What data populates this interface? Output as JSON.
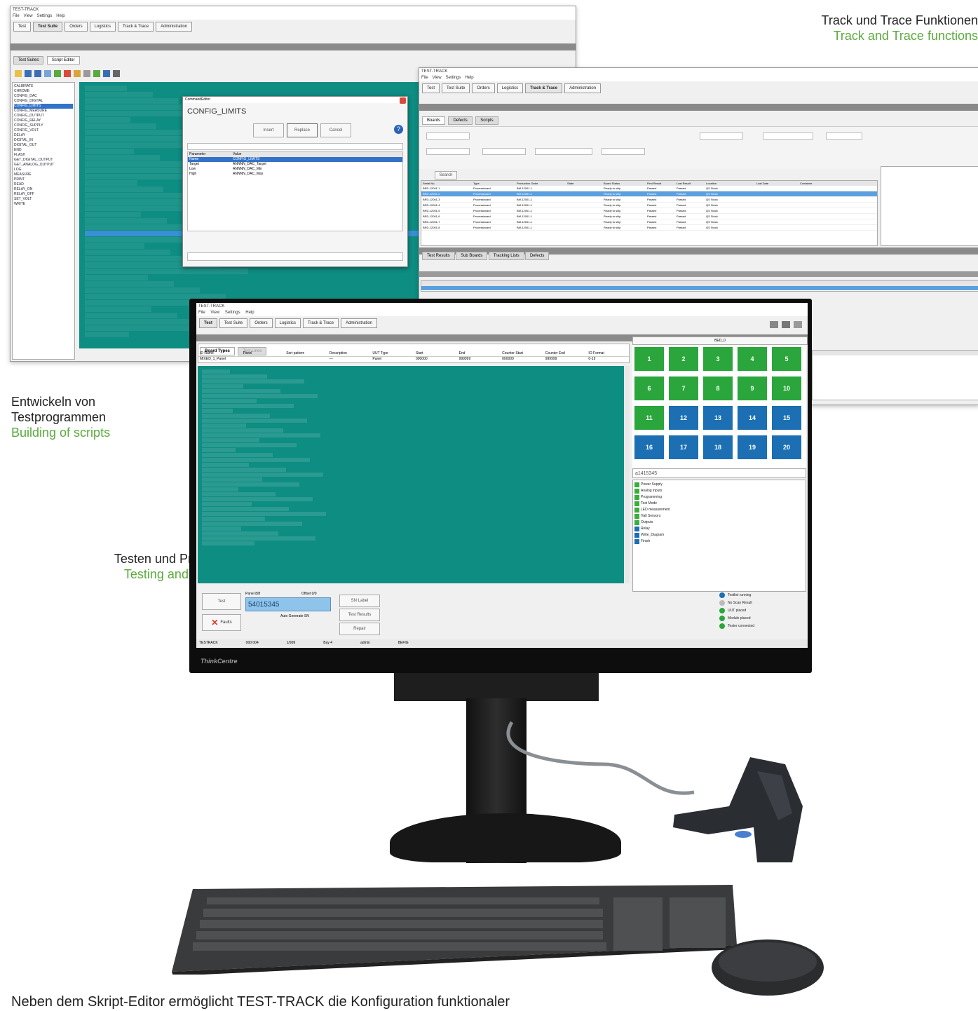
{
  "captions": {
    "track_de": "Track und Trace Funktionen",
    "track_en": "Track and Trace functions",
    "build_de_1": "Entwickeln von",
    "build_de_2": "Testprogrammen",
    "build_en": "Building of scripts",
    "test_de": "Testen und Programmieren",
    "test_en": "Testing and programming",
    "bottom": "Neben dem Skript-Editor ermöglicht TEST-TRACK die Konfiguration funktionaler"
  },
  "main_tabs": [
    "Test",
    "Test Suite",
    "Orders",
    "Logistics",
    "Track & Trace",
    "Administration"
  ],
  "editor_window": {
    "subtabs": [
      "Test Suites",
      "Script Editor"
    ],
    "dialog_title": "CONFIG_LIMITS",
    "dialog_buttons": [
      "Insert",
      "Replace",
      "Cancel"
    ],
    "dialog_columns": [
      "Parameter",
      "Value"
    ],
    "dialog_rows": [
      [
        "Name",
        "CONFIG_LIMITS"
      ],
      [
        "Target",
        "ANNNN_DAC_Target"
      ],
      [
        "Low",
        "ANNNN_DAC_Min"
      ],
      [
        "High",
        "ANNNN_DAC_Max"
      ]
    ],
    "side_list": [
      "CALIBRATE",
      "CHROME",
      "CONFIG_DAC",
      "CONFIG_DIGITAL",
      "CONFIG_LIMITS",
      "CONFIG_MEASURE",
      "CONFIG_OUTPUT",
      "CONFIG_RELAY",
      "CONFIG_SUPPLY",
      "CONFIG_VOLT",
      "DELAY",
      "DIGITAL_IN",
      "DIGITAL_OUT",
      "END",
      "FLASH",
      "GET_DIGITAL_OUTPUT",
      "GET_ANALOG_OUTPUT",
      "LOG",
      "MEASURE",
      "PRINT",
      "READ",
      "RELAY_ON",
      "RELAY_OFF",
      "SET_VOLT",
      "WRITE"
    ]
  },
  "track_window": {
    "subtabs": [
      "Boards",
      "Defects",
      "Scripts"
    ],
    "search_label": "Search",
    "columns": [
      "Serial No.",
      "Type",
      "Production Order",
      "State",
      "Board Status",
      "First Result",
      "Last Result",
      "Location",
      "Last Date",
      "Container"
    ],
    "rows": [
      [
        "BRD-12001-1",
        "Processboard",
        "BM-12001-1",
        "Ready to ship",
        "Passed",
        "Passed",
        "QS Stock"
      ],
      [
        "BRD-12001-2",
        "Processboard",
        "BM-12001-1",
        "Ready to ship",
        "Passed",
        "Passed",
        "QS Stock"
      ],
      [
        "BRD-12001-3",
        "Processboard",
        "BM-12001-1",
        "Ready to ship",
        "Passed",
        "Passed",
        "QS Stock"
      ],
      [
        "BRD-12001-4",
        "Processboard",
        "BM-12001-1",
        "Ready to ship",
        "Passed",
        "Passed",
        "QS Stock"
      ],
      [
        "BRD-12001-5",
        "Processboard",
        "BM-12001-1",
        "Ready to ship",
        "Passed",
        "Passed",
        "QS Stock"
      ],
      [
        "BRD-12001-6",
        "Processboard",
        "BM-12001-1",
        "Ready to ship",
        "Passed",
        "Passed",
        "QS Stock"
      ],
      [
        "BRD-12001-7",
        "Processboard",
        "BM-12001-1",
        "Ready to ship",
        "Passed",
        "Passed",
        "QS Stock"
      ],
      [
        "BRD-12001-8",
        "Processboard",
        "BM-12001-1",
        "Ready to ship",
        "Passed",
        "Passed",
        "QS Stock"
      ]
    ],
    "lower_tabs": [
      "Test Results",
      "Sub Boards",
      "Tracking Lists",
      "Defects"
    ]
  },
  "test_window": {
    "title": "TEST-TRACK",
    "menu": [
      "File",
      "View",
      "Settings",
      "Help"
    ],
    "subtabs": [
      "Board Types",
      "Test Lines"
    ],
    "board_columns": [
      "ID Name",
      "Panel",
      "Sort pattern",
      "Description",
      "UUT Type",
      "Start",
      "End",
      "Counter Start",
      "Counter End",
      "IO Format"
    ],
    "board_row": [
      "MIXED_1_Panel",
      "",
      "",
      "—",
      "Panel",
      "000000",
      "999999",
      "000000",
      "999999",
      "0-19"
    ],
    "panel_header": "BED_0",
    "panel_cells": [
      {
        "n": "1",
        "c": "g"
      },
      {
        "n": "2",
        "c": "g"
      },
      {
        "n": "3",
        "c": "g"
      },
      {
        "n": "4",
        "c": "g"
      },
      {
        "n": "5",
        "c": "g"
      },
      {
        "n": "6",
        "c": "g"
      },
      {
        "n": "7",
        "c": "g"
      },
      {
        "n": "8",
        "c": "g"
      },
      {
        "n": "9",
        "c": "g"
      },
      {
        "n": "10",
        "c": "g"
      },
      {
        "n": "11",
        "c": "g"
      },
      {
        "n": "12",
        "c": "b"
      },
      {
        "n": "13",
        "c": "b"
      },
      {
        "n": "14",
        "c": "b"
      },
      {
        "n": "15",
        "c": "b"
      },
      {
        "n": "16",
        "c": "b"
      },
      {
        "n": "17",
        "c": "b"
      },
      {
        "n": "18",
        "c": "b"
      },
      {
        "n": "19",
        "c": "b"
      },
      {
        "n": "20",
        "c": "b"
      }
    ],
    "serial_display": "a1415345",
    "checklist": [
      {
        "label": "Power Supply",
        "state": "g"
      },
      {
        "label": "Analog inputs",
        "state": "g"
      },
      {
        "label": "Programming",
        "state": "g"
      },
      {
        "label": "Test Mode",
        "state": "g"
      },
      {
        "label": "LED measurement",
        "state": "g"
      },
      {
        "label": "Hall Sensors",
        "state": "g"
      },
      {
        "label": "Outputs",
        "state": "g"
      },
      {
        "label": "Relay",
        "state": "b"
      },
      {
        "label": "Write_Diagram",
        "state": "b"
      },
      {
        "label": "Finish",
        "state": "b"
      }
    ],
    "panel_label": "Panel",
    "panel_count": "8/8",
    "offset_label": "Offset 0/0",
    "serial_input": "54015345",
    "auto_generate": "Auto Generate SN",
    "buttons": [
      "Test",
      "Faults",
      "SN Label",
      "Test Results",
      "Repair"
    ],
    "status": [
      {
        "label": "Testlist running",
        "color": "#1b6fb2"
      },
      {
        "label": "No Scan Result",
        "color": "#bbbbbb"
      },
      {
        "label": "UUT placed",
        "color": "#2aa63c"
      },
      {
        "label": "Module placed",
        "color": "#2aa63c"
      },
      {
        "label": "Tester connected",
        "color": "#2aa63c"
      }
    ],
    "statusbar": [
      "TESTRACK",
      "000 004",
      "1/999",
      "Bay 4",
      "admin",
      "BEFIG"
    ]
  },
  "monitor_brand": "ThinkCentre"
}
